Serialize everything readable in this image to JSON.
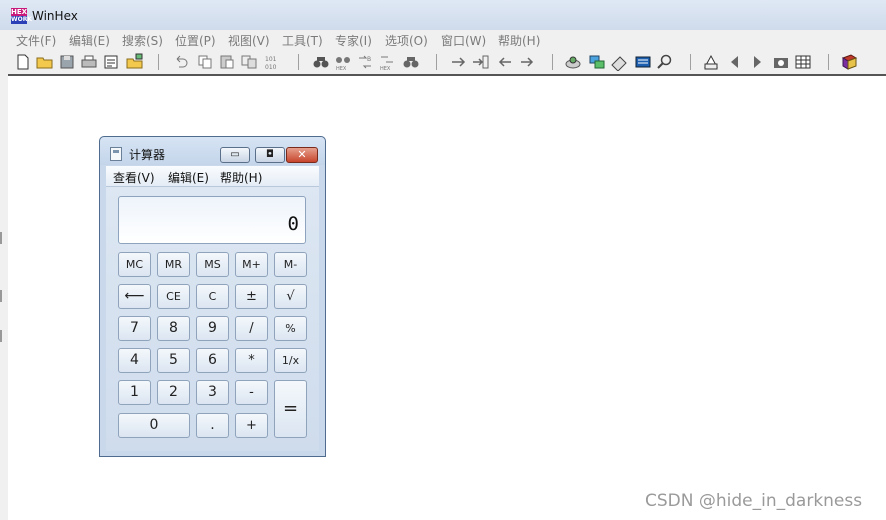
{
  "winhex": {
    "title": "WinHex",
    "logo_top": "HEX",
    "logo_bottom": "WORK",
    "menu": [
      "文件(F)",
      "编辑(E)",
      "搜索(S)",
      "位置(P)",
      "视图(V)",
      "工具(T)",
      "专家(I)",
      "选项(O)",
      "窗口(W)",
      "帮助(H)"
    ],
    "toolbar_icons": [
      "new-file-icon",
      "open-folder-icon",
      "save-icon",
      "print-icon",
      "properties-icon",
      "open-disk-icon",
      "undo-icon",
      "copy-icon",
      "paste-icon",
      "copy-block-icon",
      "hex-convert-icon",
      "find-text-icon",
      "find-hex-icon",
      "replace-text-icon",
      "replace-hex-icon",
      "find-next-icon",
      "goto-offset-icon",
      "goto-sector-icon",
      "back-icon",
      "forward-icon",
      "disk-icon",
      "ram-icon",
      "drive-icon",
      "calculator-icon",
      "search-icon",
      "hash-icon",
      "prev-icon",
      "next-icon",
      "snapshot-icon",
      "table-icon",
      "book-icon"
    ]
  },
  "calculator": {
    "title": "计算器",
    "menu": [
      "查看(V)",
      "编辑(E)",
      "帮助(H)"
    ],
    "display": "0",
    "keys": {
      "mc": "MC",
      "mr": "MR",
      "ms": "MS",
      "mplus": "M+",
      "mminus": "M-",
      "back": "⟵",
      "ce": "CE",
      "c": "C",
      "plusminus": "±",
      "sqrt": "√",
      "d7": "7",
      "d8": "8",
      "d9": "9",
      "div": "/",
      "pct": "%",
      "d4": "4",
      "d5": "5",
      "d6": "6",
      "mul": "*",
      "recip": "1/x",
      "d1": "1",
      "d2": "2",
      "d3": "3",
      "sub": "-",
      "eq": "=",
      "d0": "0",
      "dot": ".",
      "add": "+"
    }
  },
  "watermark": "CSDN @hide_in_darkness"
}
